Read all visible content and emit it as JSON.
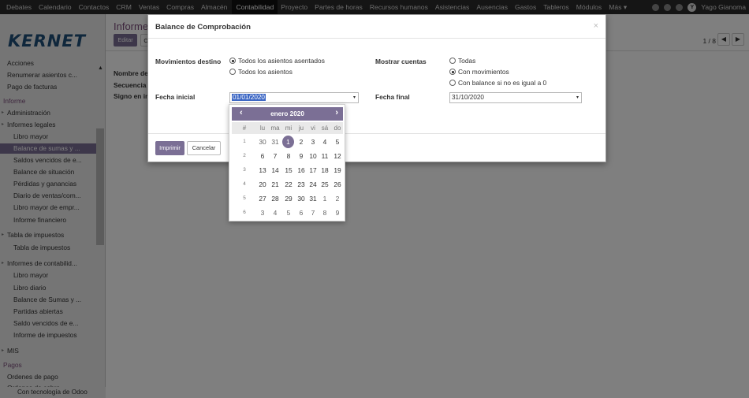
{
  "topbar": {
    "menu": [
      "Debates",
      "Calendario",
      "Contactos",
      "CRM",
      "Ventas",
      "Compras",
      "Almacén",
      "Contabilidad",
      "Proyecto",
      "Partes de horas",
      "Recursos humanos",
      "Asistencias",
      "Ausencias",
      "Gastos",
      "Tableros",
      "Módulos",
      "Más"
    ],
    "active_index": 7,
    "user_initial": "Y",
    "user_name": "Yago Gianoma"
  },
  "sidebar": {
    "logo": "KERNET",
    "items": [
      {
        "label": "Acciones",
        "level": "l1"
      },
      {
        "label": "Renumerar asientos c...",
        "level": "l1"
      },
      {
        "label": "Pago de facturas",
        "level": "l1"
      },
      {
        "label": "Informe",
        "level": "head"
      },
      {
        "label": "Administración",
        "level": "l1"
      },
      {
        "label": "Informes legales",
        "level": "l1"
      },
      {
        "label": "Libro mayor",
        "level": "l2"
      },
      {
        "label": "Balance de sumas y ...",
        "level": "l2"
      },
      {
        "label": "Saldos vencidos de e...",
        "level": "l2"
      },
      {
        "label": "Balance de situación",
        "level": "l2"
      },
      {
        "label": "Pérdidas y ganancias",
        "level": "l2"
      },
      {
        "label": "Diario de ventas/com...",
        "level": "l2"
      },
      {
        "label": "Libro mayor de empr...",
        "level": "l2"
      },
      {
        "label": "Informe financiero",
        "level": "l2"
      },
      {
        "label": "Tabla de impuestos",
        "level": "l1"
      },
      {
        "label": "Tabla de impuestos",
        "level": "l2"
      },
      {
        "label": "Informes de contabilid...",
        "level": "l1"
      },
      {
        "label": "Libro mayor",
        "level": "l2"
      },
      {
        "label": "Libro diario",
        "level": "l2"
      },
      {
        "label": "Balance de Sumas y ...",
        "level": "l2"
      },
      {
        "label": "Partidas abiertas",
        "level": "l2"
      },
      {
        "label": "Saldo vencidos de e...",
        "level": "l2"
      },
      {
        "label": "Informe de impuestos",
        "level": "l2"
      },
      {
        "label": "MIS",
        "level": "l1"
      },
      {
        "label": "Pagos",
        "level": "head"
      },
      {
        "label": "Ordenes de pago",
        "level": "l1"
      },
      {
        "label": "Ordenes de cobro",
        "level": "l1"
      }
    ],
    "footer": "Con tecnología de Odoo"
  },
  "main": {
    "title": "Informes",
    "edit_label": "Editar",
    "create_label": "C",
    "pager": "1 / 8",
    "field_labels": [
      "Nombre del",
      "Secuencia",
      "Signo en inf"
    ]
  },
  "modal": {
    "title": "Balance de Comprobación",
    "close": "×",
    "movimientos_label": "Movimientos destino",
    "movimientos_options": [
      "Todos los asientos asentados",
      "Todos los asientos"
    ],
    "movimientos_selected": 0,
    "mostrar_label": "Mostrar cuentas",
    "mostrar_options": [
      "Todas",
      "Con movimientos",
      "Con balance si no es igual a 0"
    ],
    "mostrar_selected": 1,
    "fecha_inicial_label": "Fecha inicial",
    "fecha_inicial": "01/01/2020",
    "fecha_final_label": "Fecha final",
    "fecha_final": "31/10/2020",
    "print_label": "Imprimir",
    "cancel_label": "Cancelar"
  },
  "datepicker": {
    "month": "enero 2020",
    "weekdays": [
      "#",
      "lu",
      "ma",
      "mi",
      "ju",
      "vi",
      "sá",
      "do"
    ],
    "weeks": [
      {
        "wk": "1",
        "days": [
          "30",
          "31",
          "1",
          "2",
          "3",
          "4",
          "5"
        ]
      },
      {
        "wk": "2",
        "days": [
          "6",
          "7",
          "8",
          "9",
          "10",
          "11",
          "12"
        ]
      },
      {
        "wk": "3",
        "days": [
          "13",
          "14",
          "15",
          "16",
          "17",
          "18",
          "19"
        ]
      },
      {
        "wk": "4",
        "days": [
          "20",
          "21",
          "22",
          "23",
          "24",
          "25",
          "26"
        ]
      },
      {
        "wk": "5",
        "days": [
          "27",
          "28",
          "29",
          "30",
          "31",
          "1",
          "2"
        ]
      },
      {
        "wk": "6",
        "days": [
          "3",
          "4",
          "5",
          "6",
          "7",
          "8",
          "9"
        ]
      }
    ],
    "selected_day": "1"
  }
}
